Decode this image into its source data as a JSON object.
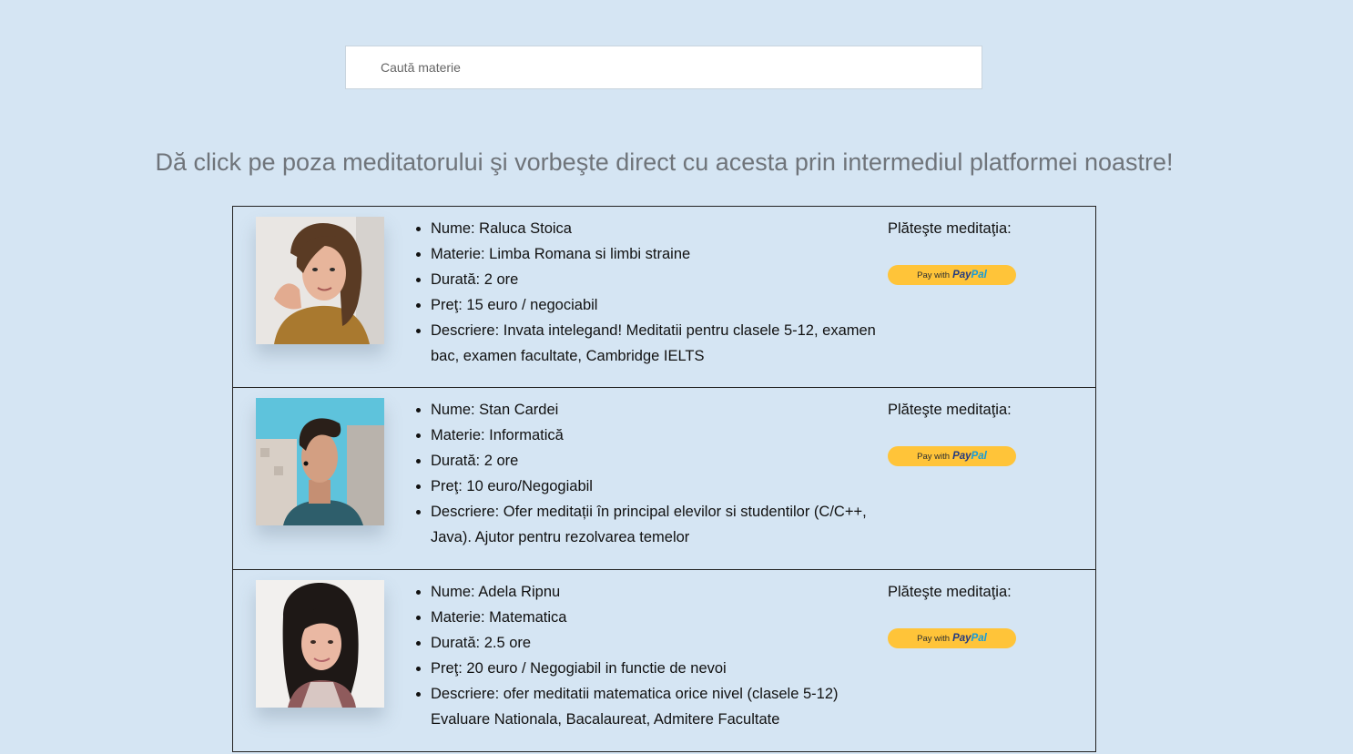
{
  "search": {
    "placeholder": "Caută materie"
  },
  "headline": "Dă click pe poza meditatorului şi vorbeşte direct cu acesta prin intermediul platformei noastre!",
  "paypal": {
    "prefix": "Pay with",
    "brand_part1": "Pay",
    "brand_part2": "Pal"
  },
  "colors": {
    "background": "#d5e5f3",
    "paypal_button": "#ffc439",
    "paypal_dark_blue": "#253b80",
    "paypal_light_blue": "#179bd7"
  },
  "tutors": [
    {
      "name": "Nume: Raluca Stoica",
      "subject": "Materie: Limba Romana si limbi straine",
      "duration": "Durată: 2 ore",
      "price": "Preţ: 15 euro / negociabil",
      "description": "Descriere: Invata intelegand! Meditatii pentru clasele 5-12, examen bac, examen facultate, Cambridge IELTS",
      "pay_label": "Plăteşte meditaţia:",
      "photo_icon": "tutor-photo"
    },
    {
      "name": "Nume: Stan Cardei",
      "subject": "Materie: Informatică",
      "duration": "Durată: 2 ore",
      "price": "Preţ: 10 euro/Negogiabil",
      "description": "Descriere: Ofer meditații în principal elevilor si studentilor (C/C++, Java). Ajutor pentru rezolvarea temelor",
      "pay_label": "Plăteşte meditaţia:",
      "photo_icon": "tutor-photo"
    },
    {
      "name": "Nume: Adela Ripnu",
      "subject": "Materie: Matematica",
      "duration": "Durată: 2.5 ore",
      "price": "Preţ: 20 euro / Negogiabil in functie de nevoi",
      "description": "Descriere: ofer meditatii matematica orice nivel (clasele 5-12) Evaluare Nationala, Bacalaureat, Admitere Facultate",
      "pay_label": "Plăteşte meditaţia:",
      "photo_icon": "tutor-photo"
    }
  ]
}
